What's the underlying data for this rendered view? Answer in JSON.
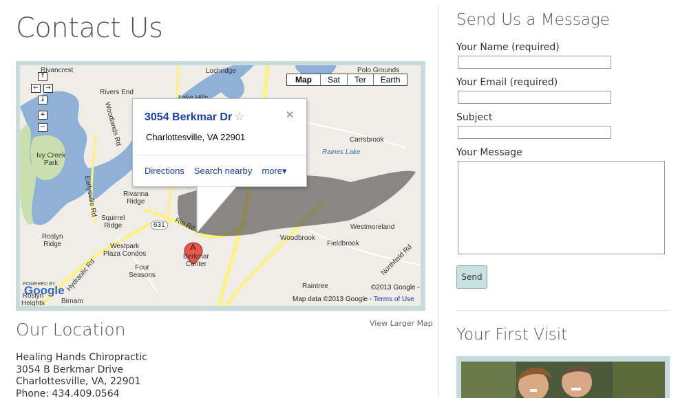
{
  "page": {
    "title": "Contact Us"
  },
  "map": {
    "type_buttons": [
      "Map",
      "Sat",
      "Ter",
      "Earth"
    ],
    "nav_glyphs": {
      "up": "↑",
      "left": "←",
      "right": "→",
      "down": "↓",
      "zoom_in": "+",
      "zoom_out": "−"
    },
    "bubble": {
      "title": "3054 Berkmar Dr",
      "star": "☆",
      "close": "✕",
      "address": "Charlottesville, VA 22901",
      "links": [
        "Directions",
        "Search nearby",
        "more▾"
      ]
    },
    "marker_label": "A",
    "places": [
      {
        "name": "Rivancrest"
      },
      {
        "name": "Lochridge"
      },
      {
        "name": "Polo Grounds"
      },
      {
        "name": "Rivers End"
      },
      {
        "name": "Lake Hills"
      },
      {
        "name": "Ivy Creek\nPark"
      },
      {
        "name": "Carrsbrook"
      },
      {
        "name": "Raines Lake"
      },
      {
        "name": "Rivanna\nRidge"
      },
      {
        "name": "Squirrel\nRidge"
      },
      {
        "name": "Roslyn\nRidge"
      },
      {
        "name": "Westpark\nPlaza Condos"
      },
      {
        "name": "Four\nSeasons"
      },
      {
        "name": "Berkmar\nCenter"
      },
      {
        "name": "Woodbrook"
      },
      {
        "name": "Fieldbrook"
      },
      {
        "name": "Westmoreland"
      },
      {
        "name": "Raintree"
      },
      {
        "name": "Roslyn\nHeights"
      },
      {
        "name": "Birnam"
      },
      {
        "name": "Northfield Rd"
      },
      {
        "name": "Rio Rd E"
      },
      {
        "name": "Hydraulic Rd"
      },
      {
        "name": "Earlysville Rd"
      },
      {
        "name": "Woodlands Rd"
      },
      {
        "name": "631"
      }
    ],
    "powered_by": "POWERED BY",
    "logo_text": "Google",
    "copyright_top": "©2013 Google -",
    "copyright_bottom": "Map data ©2013 Google -",
    "terms_link": "Terms of Use",
    "colors": {
      "land": "#efede6",
      "water": "#8fb0d7",
      "park": "#c9dfae",
      "road_major": "#fdf27a",
      "road_minor": "#ffffff"
    }
  },
  "view_larger_map": "View Larger Map",
  "location": {
    "heading": "Our Location",
    "lines": [
      "Healing Hands Chiropractic",
      "3054 B Berkmar Drive",
      "Charlottesville, VA, 22901",
      "Phone: 434.409.0564"
    ]
  },
  "form": {
    "heading": "Send Us a Message",
    "name_label": "Your Name (required)",
    "name_value": "",
    "email_label": "Your Email (required)",
    "email_value": "",
    "subject_label": "Subject",
    "subject_value": "",
    "message_label": "Your Message",
    "message_value": "",
    "send_label": "Send"
  },
  "first_visit": {
    "heading": "Your First Visit"
  }
}
